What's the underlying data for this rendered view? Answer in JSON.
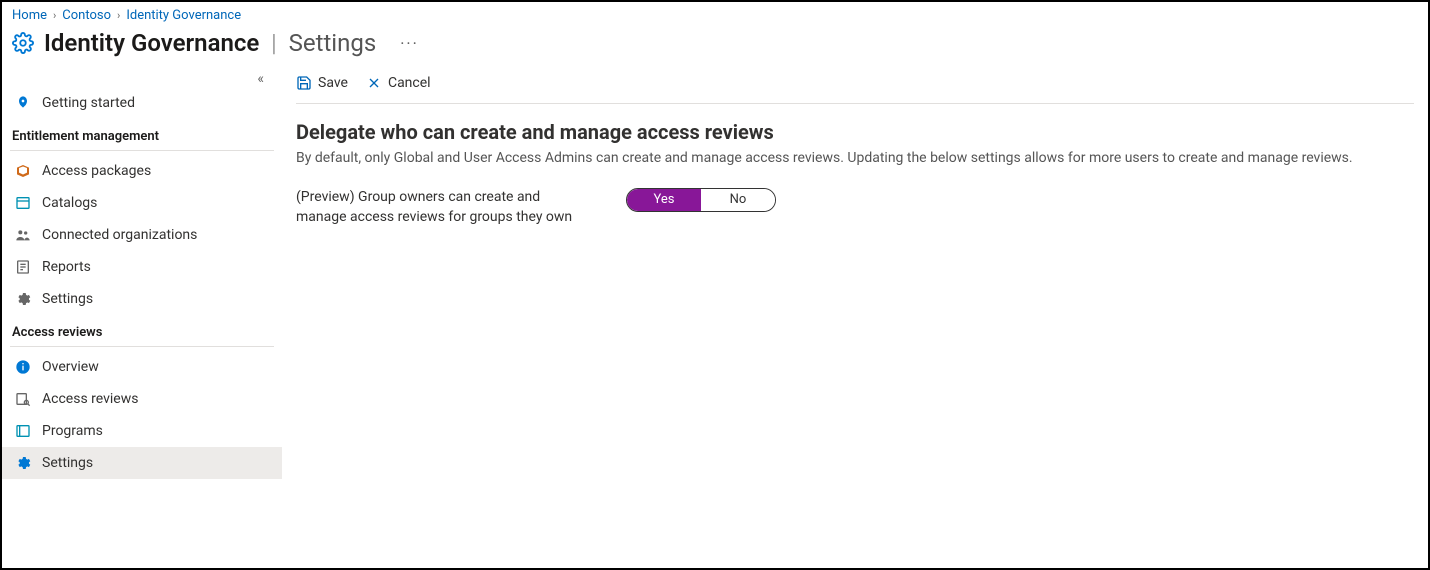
{
  "breadcrumb": {
    "items": [
      "Home",
      "Contoso",
      "Identity Governance"
    ]
  },
  "header": {
    "title": "Identity Governance",
    "subtitle": "Settings"
  },
  "sidebar": {
    "getting_started": "Getting started",
    "section_entitlement": "Entitlement management",
    "access_packages": "Access packages",
    "catalogs": "Catalogs",
    "connected_orgs": "Connected organizations",
    "reports": "Reports",
    "settings_em": "Settings",
    "section_access_reviews": "Access reviews",
    "overview": "Overview",
    "access_reviews": "Access reviews",
    "programs": "Programs",
    "settings_ar": "Settings"
  },
  "toolbar": {
    "save_label": "Save",
    "cancel_label": "Cancel"
  },
  "content": {
    "section_title": "Delegate who can create and manage access reviews",
    "section_desc": "By default, only Global and User Access Admins can create and manage access reviews. Updating the below settings allows for more users to create and manage reviews.",
    "setting_label": "(Preview) Group owners can create and manage access reviews for groups they own",
    "toggle": {
      "yes": "Yes",
      "no": "No",
      "value": "Yes"
    }
  }
}
